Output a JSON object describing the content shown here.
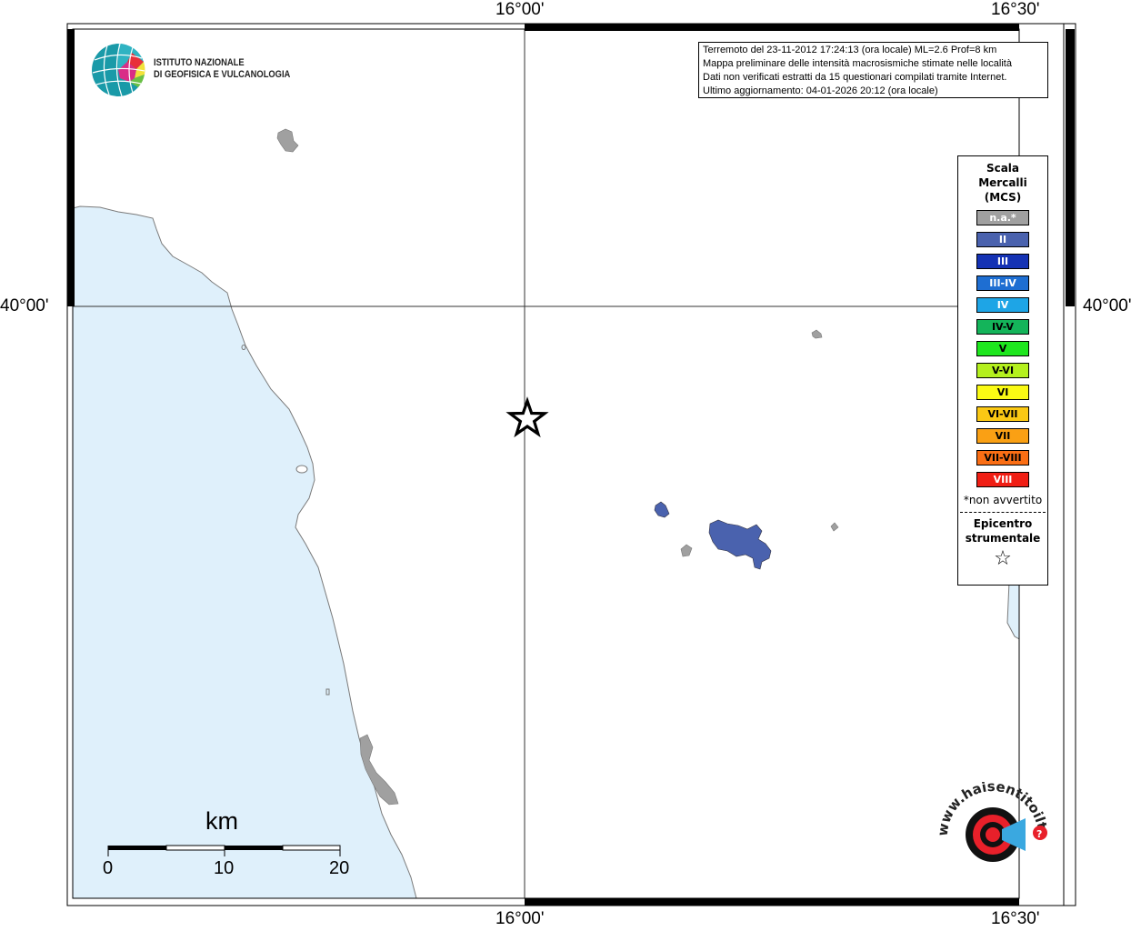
{
  "map": {
    "lon_labels": {
      "left": "16°00'",
      "right": "16°30'"
    },
    "lat_label": "40°00'",
    "colors": {
      "sea": "#dff0fb",
      "coast": "#7a7a7a",
      "locality_na": "#a0a0a0",
      "locality_ii": "#4a62ae"
    }
  },
  "logo": {
    "icon": "ingv-globe-icon",
    "line1": "ISTITUTO NAZIONALE",
    "line2": "DI GEOFISICA E VULCANOLOGIA"
  },
  "info": {
    "line1": "Terremoto del 23-11-2012 17:24:13 (ora locale) ML=2.6 Prof=8 km",
    "line2": "Mappa preliminare delle intensità macrosismiche stimate nelle località",
    "line3": "Dati non verificati estratti da 15 questionari compilati tramite Internet.",
    "line4": "Ultimo aggiornamento: 04-01-2026 20:12 (ora locale)"
  },
  "legend": {
    "title1": "Scala",
    "title2": "Mercalli",
    "title3": "(MCS)",
    "items": [
      {
        "label": "n.a.*",
        "color": "#a0a0a0",
        "text_color": "#ffffff"
      },
      {
        "label": "II",
        "color": "#4a62ae",
        "text_color": "#ffffff"
      },
      {
        "label": "III",
        "color": "#1432b4",
        "text_color": "#ffffff"
      },
      {
        "label": "III-IV",
        "color": "#1e6ed2",
        "text_color": "#ffffff"
      },
      {
        "label": "IV",
        "color": "#1ea5e6",
        "text_color": "#ffffff"
      },
      {
        "label": "IV-V",
        "color": "#14b45a",
        "text_color": "#000000"
      },
      {
        "label": "V",
        "color": "#1ee61e",
        "text_color": "#000000"
      },
      {
        "label": "V-VI",
        "color": "#b4f01e",
        "text_color": "#000000"
      },
      {
        "label": "VI",
        "color": "#fafa14",
        "text_color": "#000000"
      },
      {
        "label": "VI-VII",
        "color": "#fac814",
        "text_color": "#000000"
      },
      {
        "label": "VII",
        "color": "#faa014",
        "text_color": "#000000"
      },
      {
        "label": "VII-VIII",
        "color": "#fa6e14",
        "text_color": "#000000"
      },
      {
        "label": "VIII",
        "color": "#f01e14",
        "text_color": "#ffffff"
      }
    ],
    "note": "*non avvertito",
    "epicenter1": "Epicentro",
    "epicenter2": "strumentale",
    "epicenter_icon": "star-icon"
  },
  "scalebar": {
    "title": "km",
    "labels": [
      "0",
      "10",
      "20"
    ]
  },
  "badge": {
    "icon": "haisentito-logo-icon",
    "text": "www.haisentitoilterremoto.it"
  }
}
